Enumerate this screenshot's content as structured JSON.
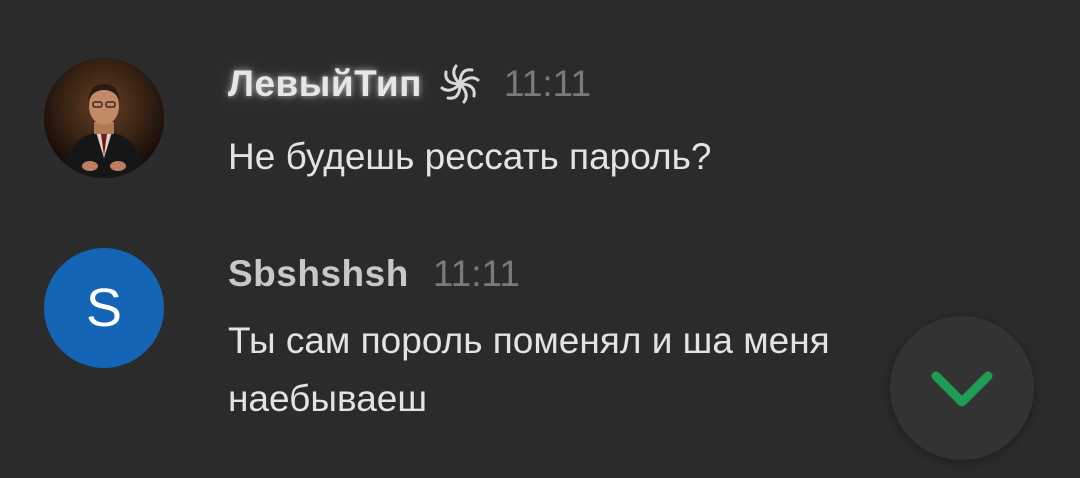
{
  "messages": [
    {
      "author": "ЛевыйТип",
      "time": "11:11",
      "lines": [
        "Не будешь рессать пароль?"
      ],
      "avatar": "photo",
      "badge_icon": "swirl-badge-icon"
    },
    {
      "author": "Sbshshsh",
      "time": "11:11",
      "lines": [
        "Ты сам пороль поменял и ша меня",
        "наебываеш"
      ],
      "avatar_letter": "S",
      "avatar_color": "#1565b7"
    }
  ],
  "scroll_button": {
    "icon": "chevron-down-icon",
    "color": "#1f9d55"
  }
}
